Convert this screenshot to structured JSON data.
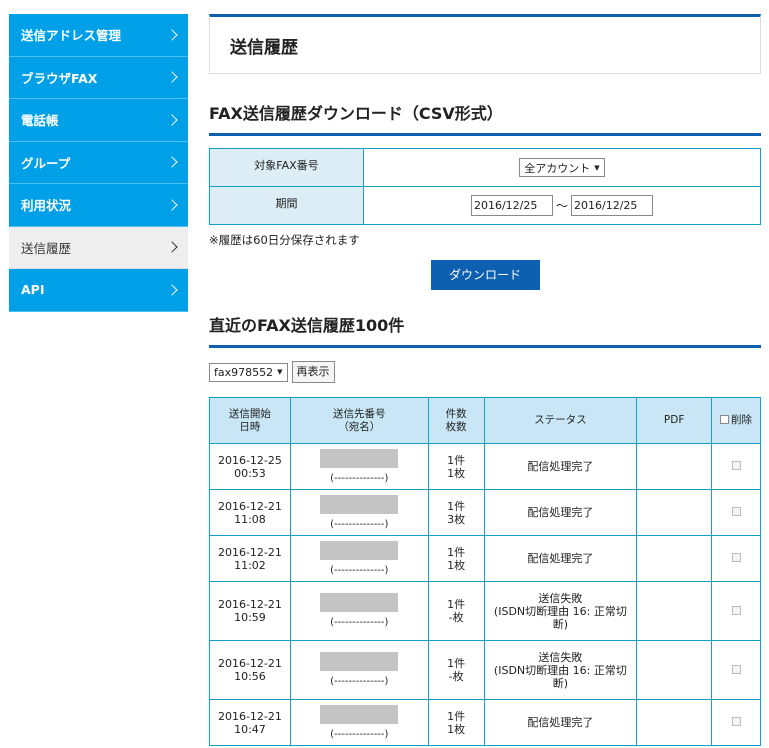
{
  "sidebar": {
    "items": [
      {
        "label": "送信アドレス管理"
      },
      {
        "label": "ブラウザFAX"
      },
      {
        "label": "電話帳"
      },
      {
        "label": "グループ"
      },
      {
        "label": "利用状況"
      },
      {
        "label": "送信履歴"
      },
      {
        "label": "API"
      }
    ]
  },
  "page_title": "送信履歴",
  "download": {
    "title": "FAX送信履歴ダウンロード（CSV形式）",
    "fax_label": "対象FAX番号",
    "fax_value": "全アカウント",
    "period_label": "期間",
    "date_from": "2016/12/25",
    "separator": "〜",
    "date_to": "2016/12/25",
    "note": "※履歴は60日分保存されます",
    "button": "ダウンロード"
  },
  "recent": {
    "title": "直近のFAX送信履歴100件",
    "filter_value": "fax978552",
    "refresh_button": "再表示",
    "headers": {
      "date": [
        "送信開始",
        "日時"
      ],
      "dest": [
        "送信先番号",
        "（宛名）"
      ],
      "count": [
        "件数",
        "枚数"
      ],
      "status": "ステータス",
      "pdf": "PDF",
      "delete": "削除"
    },
    "rows": [
      {
        "date": "2016-12-25",
        "time": "00:53",
        "dest_name": "(--------------)",
        "count": "1件",
        "pages": "1枚",
        "status": [
          "配信処理完了"
        ]
      },
      {
        "date": "2016-12-21",
        "time": "11:08",
        "dest_name": "(--------------)",
        "count": "1件",
        "pages": "3枚",
        "status": [
          "配信処理完了"
        ]
      },
      {
        "date": "2016-12-21",
        "time": "11:02",
        "dest_name": "(--------------)",
        "count": "1件",
        "pages": "1枚",
        "status": [
          "配信処理完了"
        ]
      },
      {
        "date": "2016-12-21",
        "time": "10:59",
        "dest_name": "(--------------)",
        "count": "1件",
        "pages": "-枚",
        "status": [
          "送信失敗",
          "(ISDN切断理由 16: 正常切",
          "断)"
        ]
      },
      {
        "date": "2016-12-21",
        "time": "10:56",
        "dest_name": "(--------------)",
        "count": "1件",
        "pages": "-枚",
        "status": [
          "送信失敗",
          "(ISDN切断理由 16: 正常切",
          "断)"
        ]
      },
      {
        "date": "2016-12-21",
        "time": "10:47",
        "dest_name": "(--------------)",
        "count": "1件",
        "pages": "1枚",
        "status": [
          "配信処理完了"
        ]
      }
    ]
  },
  "colors": {
    "sidebar": "#00a0e9",
    "accent": "#0d5fb0",
    "table_border": "#14a1c9",
    "table_header": "#c8e6f5"
  }
}
